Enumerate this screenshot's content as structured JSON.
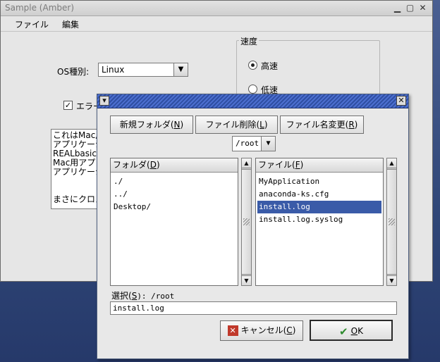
{
  "main_window": {
    "title": "Sample (Amber)",
    "menu": [
      "ファイル",
      "編集"
    ],
    "os_label": "OS種別:",
    "os_value": "Linux",
    "speed_group": "速度",
    "speed_options": [
      {
        "label": "高速",
        "selected": true
      },
      {
        "label": "低速",
        "selected": false
      }
    ],
    "error_checkbox_label": "エラー",
    "error_checked": true,
    "text_lines": [
      "これはMac用",
      "アプリケーシ",
      "REALbasicで",
      "Mac用アプリ",
      "アプリケーシ",
      "",
      "",
      "まさにクロス"
    ]
  },
  "dialog": {
    "buttons": {
      "new_folder": "新規フォルダ(N)",
      "new_folder_text": "新規フォルダ(",
      "new_folder_key": "N",
      "delete_file_text": "ファイル削除(",
      "delete_file_key": "L",
      "rename_text": "ファイル名変更(",
      "rename_key": "R",
      "close": ")"
    },
    "path": "/root",
    "folder_header_text": "フォルダ(",
    "folder_header_key": "D",
    "file_header_text": "ファイル(",
    "file_header_key": "F",
    "folders": [
      "./",
      "../",
      "Desktop/"
    ],
    "files": [
      {
        "name": "MyApplication",
        "selected": false
      },
      {
        "name": "anaconda-ks.cfg",
        "selected": false
      },
      {
        "name": "install.log",
        "selected": true
      },
      {
        "name": "install.log.syslog",
        "selected": false
      }
    ],
    "selection_label_text": "選択(",
    "selection_label_key": "S",
    "selection_label_after": "): /root",
    "selection_value": "install.log",
    "cancel_text": "キャンセル(",
    "cancel_key": "C",
    "ok_key": "O",
    "ok_rest": "K"
  },
  "colors": {
    "selection": "#3a5ba8",
    "dialog_title": "#2f4fa3",
    "desktop": "#2d3f6e"
  }
}
